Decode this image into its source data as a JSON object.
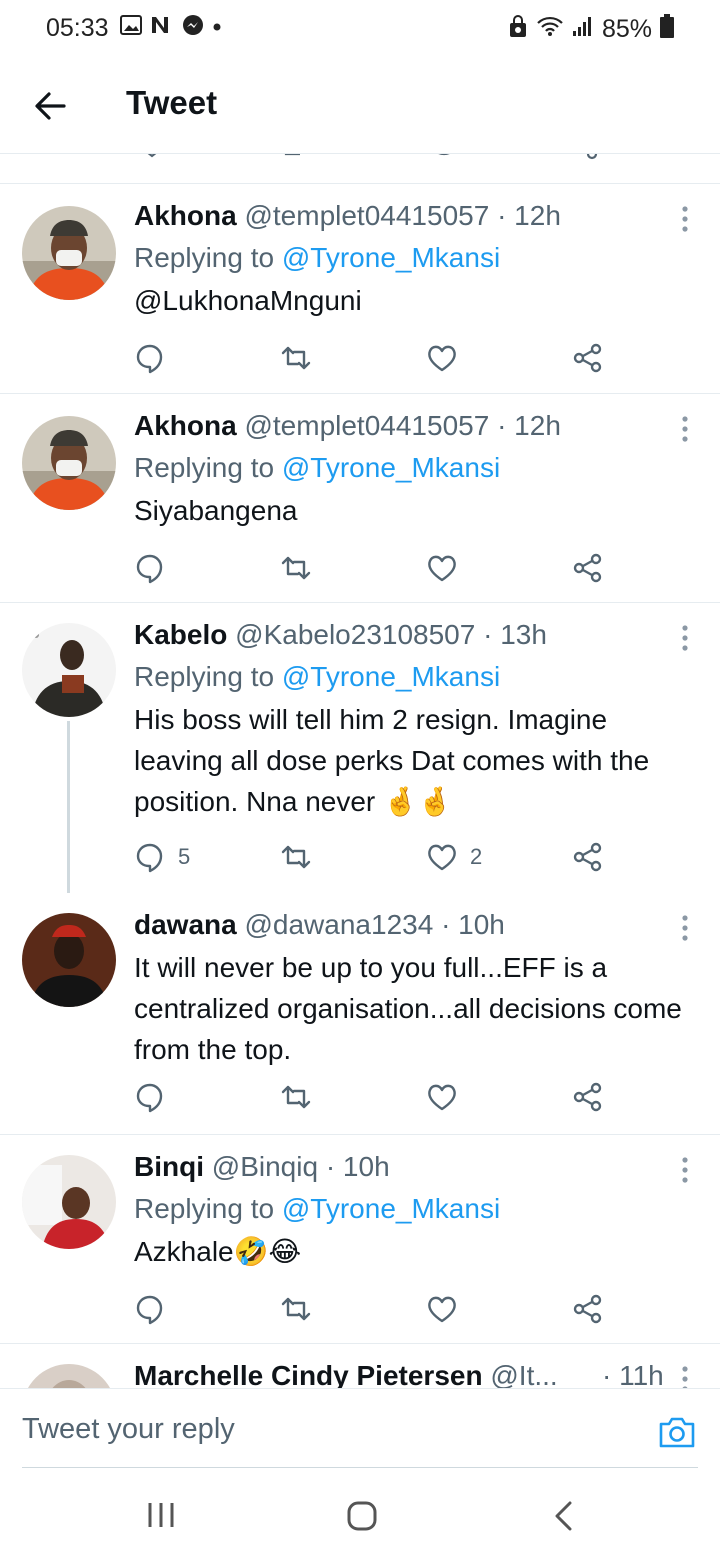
{
  "status_bar": {
    "time": "05:33",
    "battery": "85%"
  },
  "header": {
    "title": "Tweet"
  },
  "tweets": [
    {
      "name": "Akhona",
      "handle": "@templet04415057",
      "time": "· 12h",
      "replying_label": "Replying to",
      "replying_to": "@Tyrone_Mkansi",
      "text": "@LukhonaMnguni",
      "replies": "",
      "likes": ""
    },
    {
      "name": "Akhona",
      "handle": "@templet04415057",
      "time": "· 12h",
      "replying_label": "Replying to",
      "replying_to": "@Tyrone_Mkansi",
      "text": "Siyabangena",
      "replies": "",
      "likes": ""
    },
    {
      "name": "Kabelo",
      "handle": "@Kabelo23108507",
      "time": "· 13h",
      "replying_label": "Replying to",
      "replying_to": "@Tyrone_Mkansi",
      "text": "His boss will tell him 2 resign. Imagine leaving all dose perks Dat comes with the position. Nna never 🤞🤞",
      "replies": "5",
      "likes": "2"
    },
    {
      "name": "dawana",
      "handle": "@dawana1234",
      "time": "· 10h",
      "text": "It will never be up to you full...EFF is a centralized organisation...all decisions come from the top.",
      "replies": "",
      "likes": ""
    },
    {
      "name": "Binqi",
      "handle": "@Binqiq",
      "time": "· 10h",
      "replying_label": "Replying to",
      "replying_to": "@Tyrone_Mkansi",
      "text": "Azkhale🤣😂",
      "replies": "",
      "likes": ""
    },
    {
      "name": "Marchelle Cindy Pietersen",
      "handle": "@It...",
      "time": "· 11h"
    }
  ],
  "reply_bar": {
    "placeholder": "Tweet your reply"
  },
  "colors": {
    "accent": "#1d9bf0",
    "secondary_text": "#536471",
    "primary_text": "#0f1419",
    "divider": "#e6ecf0"
  }
}
